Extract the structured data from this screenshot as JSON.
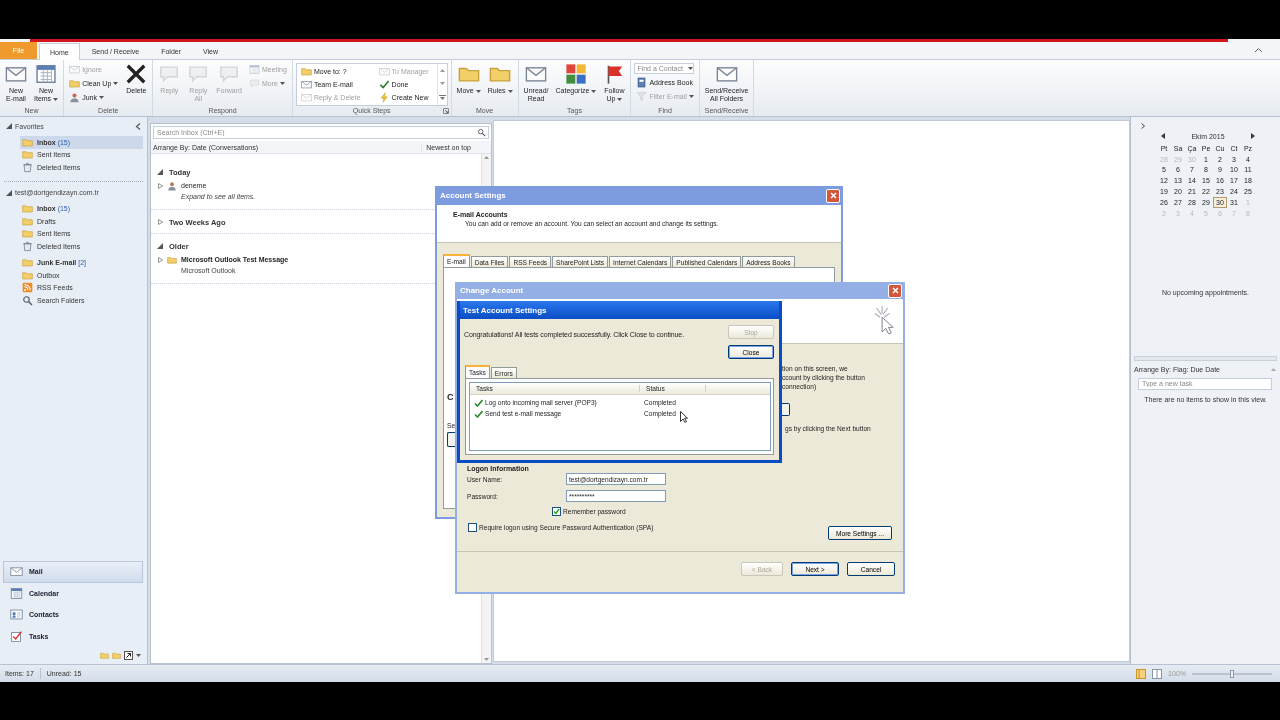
{
  "window": {
    "tabs": [
      {
        "label": "File",
        "kind": "file",
        "selected": false
      },
      {
        "label": "Home",
        "kind": "tab",
        "selected": true
      },
      {
        "label": "Send / Receive",
        "kind": "tab",
        "selected": false
      },
      {
        "label": "Folder",
        "kind": "tab",
        "selected": false
      },
      {
        "label": "View",
        "kind": "tab",
        "selected": false
      }
    ]
  },
  "ribbon": {
    "groups": [
      {
        "label": "New",
        "launcher": false,
        "buttons": [
          {
            "kind": "large",
            "label": "New\nE-mail",
            "disabled": false,
            "dropdown": false
          },
          {
            "kind": "large",
            "label": "New\nItems",
            "disabled": false,
            "dropdown": true
          }
        ]
      },
      {
        "label": "Delete",
        "launcher": false,
        "buttons": [
          {
            "kind": "small",
            "label": "Ignore",
            "disabled": true,
            "dropdown": false
          },
          {
            "kind": "small",
            "label": "Clean Up",
            "disabled": false,
            "dropdown": true
          },
          {
            "kind": "small",
            "label": "Junk",
            "disabled": false,
            "dropdown": true
          },
          {
            "kind": "large",
            "label": "Delete",
            "disabled": false,
            "dropdown": false
          }
        ]
      },
      {
        "label": "Respond",
        "launcher": false,
        "buttons": [
          {
            "kind": "large",
            "label": "Reply",
            "disabled": true,
            "dropdown": false
          },
          {
            "kind": "large",
            "label": "Reply\nAll",
            "disabled": true,
            "dropdown": false
          },
          {
            "kind": "large",
            "label": "Forward",
            "disabled": true,
            "dropdown": false
          },
          {
            "kind": "small",
            "label": "Meeting",
            "disabled": true,
            "dropdown": false
          },
          {
            "kind": "small",
            "label": "More",
            "disabled": true,
            "dropdown": true
          }
        ]
      },
      {
        "label": "Quick Steps",
        "launcher": true,
        "buttons": [
          {
            "kind": "quickstep",
            "label": "Move to: ?",
            "disabled": false
          },
          {
            "kind": "quickstep",
            "label": "Team E-mail",
            "disabled": false
          },
          {
            "kind": "quickstep",
            "label": "Reply & Delete",
            "disabled": true
          },
          {
            "kind": "quickstep",
            "label": "To Manager",
            "disabled": true
          },
          {
            "kind": "quickstep",
            "label": "Done",
            "disabled": false
          },
          {
            "kind": "quickstep",
            "label": "Create New",
            "disabled": false
          }
        ]
      },
      {
        "label": "Move",
        "launcher": false,
        "buttons": [
          {
            "kind": "large",
            "label": "Move",
            "disabled": false,
            "dropdown": true
          },
          {
            "kind": "large",
            "label": "Rules",
            "disabled": false,
            "dropdown": true
          }
        ]
      },
      {
        "label": "Tags",
        "launcher": false,
        "buttons": [
          {
            "kind": "large",
            "label": "Unread/\nRead",
            "disabled": false,
            "dropdown": false
          },
          {
            "kind": "large",
            "label": "Categorize",
            "disabled": false,
            "dropdown": true
          },
          {
            "kind": "large",
            "label": "Follow\nUp",
            "disabled": false,
            "dropdown": true
          }
        ]
      },
      {
        "label": "Find",
        "launcher": false,
        "buttons": [
          {
            "kind": "field",
            "placeholder": "Find a Contact",
            "dropdown": true
          },
          {
            "kind": "small",
            "label": "Address Book",
            "disabled": false,
            "dropdown": false
          },
          {
            "kind": "small",
            "label": "Filter E-mail",
            "disabled": true,
            "dropdown": true
          }
        ]
      },
      {
        "label": "Send/Receive",
        "launcher": false,
        "buttons": [
          {
            "kind": "large",
            "label": "Send/Receive\nAll Folders",
            "disabled": false,
            "dropdown": false
          }
        ]
      }
    ]
  },
  "nav": {
    "favorites": {
      "label": "Favorites",
      "expanded": true,
      "items": [
        {
          "label": "Inbox",
          "count": "(15)",
          "unread": true,
          "selected": true
        },
        {
          "label": "Sent Items",
          "unread": false,
          "selected": false
        },
        {
          "label": "Deleted Items",
          "unread": false,
          "selected": false
        }
      ]
    },
    "account": {
      "label": "test@dortgendizayn.com.tr",
      "expanded": true,
      "items": [
        {
          "label": "Inbox",
          "count": "(15)",
          "unread": true,
          "selected": false
        },
        {
          "label": "Drafts",
          "unread": false,
          "selected": false
        },
        {
          "label": "Sent Items",
          "unread": false,
          "selected": false
        },
        {
          "label": "Deleted Items",
          "unread": false,
          "selected": false
        },
        {
          "label": "Junk E-mail",
          "count": "[2]",
          "unread": true,
          "selected": false
        },
        {
          "label": "Outbox",
          "unread": false,
          "selected": false
        },
        {
          "label": "RSS Feeds",
          "unread": false,
          "selected": false
        },
        {
          "label": "Search Folders",
          "unread": false,
          "selected": false
        }
      ]
    },
    "modules": [
      {
        "label": "Mail",
        "selected": true
      },
      {
        "label": "Calendar",
        "selected": false
      },
      {
        "label": "Contacts",
        "selected": false
      },
      {
        "label": "Tasks",
        "selected": false
      }
    ]
  },
  "message_list": {
    "search_placeholder": "Search Inbox (Ctrl+E)",
    "arrange_by": "Arrange By: Date (Conversations)",
    "sort_order": "Newest on top",
    "groups": [
      {
        "label": "Today",
        "expanded": true,
        "items": [
          {
            "kind": "conversation",
            "title": "deneme",
            "subtitle": "Expand to see all items.",
            "expanded": false
          }
        ]
      },
      {
        "label": "Two Weeks Ago",
        "expanded": false
      },
      {
        "label": "Older",
        "expanded": true,
        "items": [
          {
            "kind": "message",
            "title": "Microsoft Outlook Test Message",
            "subtitle": "Microsoft Outlook",
            "expanded": false
          }
        ]
      }
    ]
  },
  "todo": {
    "calendar": {
      "month": "Ekim 2015",
      "weekdays": [
        "Pt",
        "Sa",
        "Ça",
        "Pe",
        "Cu",
        "Ct",
        "Pz"
      ],
      "days": [
        {
          "day": "28",
          "muted": true,
          "selected": false
        },
        {
          "day": "29",
          "muted": true,
          "selected": false
        },
        {
          "day": "30",
          "muted": true,
          "selected": false
        },
        {
          "day": "1",
          "muted": false,
          "selected": false
        },
        {
          "day": "2",
          "muted": false,
          "selected": false
        },
        {
          "day": "3",
          "muted": false,
          "selected": false
        },
        {
          "day": "4",
          "muted": false,
          "selected": false
        },
        {
          "day": "5",
          "muted": false,
          "selected": false
        },
        {
          "day": "6",
          "muted": false,
          "selected": false
        },
        {
          "day": "7",
          "muted": false,
          "selected": false
        },
        {
          "day": "8",
          "muted": false,
          "selected": false
        },
        {
          "day": "9",
          "muted": false,
          "selected": false
        },
        {
          "day": "10",
          "muted": false,
          "selected": false
        },
        {
          "day": "11",
          "muted": false,
          "selected": false
        },
        {
          "day": "12",
          "muted": false,
          "selected": false
        },
        {
          "day": "13",
          "muted": false,
          "selected": false
        },
        {
          "day": "14",
          "muted": false,
          "selected": false
        },
        {
          "day": "15",
          "muted": false,
          "selected": false
        },
        {
          "day": "16",
          "muted": false,
          "selected": false
        },
        {
          "day": "17",
          "muted": false,
          "selected": false
        },
        {
          "day": "18",
          "muted": false,
          "selected": false
        },
        {
          "day": "19",
          "muted": false,
          "selected": false
        },
        {
          "day": "20",
          "muted": false,
          "selected": false
        },
        {
          "day": "21",
          "muted": false,
          "selected": false
        },
        {
          "day": "22",
          "muted": false,
          "selected": false
        },
        {
          "day": "23",
          "muted": false,
          "selected": false
        },
        {
          "day": "24",
          "muted": false,
          "selected": false
        },
        {
          "day": "25",
          "muted": false,
          "selected": false
        },
        {
          "day": "26",
          "muted": false,
          "selected": false
        },
        {
          "day": "27",
          "muted": false,
          "selected": false
        },
        {
          "day": "28",
          "muted": false,
          "selected": false
        },
        {
          "day": "29",
          "muted": false,
          "selected": false
        },
        {
          "day": "30",
          "muted": false,
          "selected": true
        },
        {
          "day": "31",
          "muted": false,
          "selected": false
        },
        {
          "day": "1",
          "muted": true,
          "selected": false
        },
        {
          "day": "2",
          "muted": true,
          "selected": false
        },
        {
          "day": "3",
          "muted": true,
          "selected": false
        },
        {
          "day": "4",
          "muted": true,
          "selected": false
        },
        {
          "day": "5",
          "muted": true,
          "selected": false
        },
        {
          "day": "6",
          "muted": true,
          "selected": false
        },
        {
          "day": "7",
          "muted": true,
          "selected": false
        },
        {
          "day": "8",
          "muted": true,
          "selected": false
        }
      ]
    },
    "appointments": "No upcoming appointments.",
    "tasks": {
      "arrange_by": "Arrange By: Flag: Due Date",
      "placeholder": "Type a new task",
      "empty": "There are no items to show in this view."
    }
  },
  "status_bar": {
    "items": "Items: 17",
    "unread": "Unread: 15",
    "zoom": "100%",
    "zoom_slider": {
      "level": 0.5
    }
  },
  "account_settings": {
    "title": "Account Settings",
    "heading": "E-mail Accounts",
    "description": "You can add or remove an account. You can select an account and change its settings.",
    "tabs": [
      {
        "label": "E-mail",
        "selected": true
      },
      {
        "label": "Data Files",
        "selected": false
      },
      {
        "label": "RSS Feeds",
        "selected": false
      },
      {
        "label": "SharePoint Lists",
        "selected": false
      },
      {
        "label": "Internet Calendars",
        "selected": false
      },
      {
        "label": "Published Calendars",
        "selected": false
      },
      {
        "label": "Address Books",
        "selected": false
      }
    ],
    "partial_texts": [
      "C",
      "Se"
    ]
  },
  "change_account": {
    "title": "Change Account",
    "partial_lines": [
      "tion on this screen, we",
      "ccount by clicking the button",
      "connection)"
    ],
    "partial_line_2": "gs by clicking the Next button",
    "logon": {
      "heading": "Logon Information",
      "fields": [
        {
          "label": "User Name:",
          "value": "test@dortgendizayn.com.tr"
        },
        {
          "label": "Password:",
          "value": "**********"
        }
      ],
      "remember": {
        "label": "Remember password",
        "checked": true
      },
      "spa": {
        "label": "Require logon using Secure Password Authentication (SPA)",
        "checked": false
      }
    },
    "more_settings": {
      "label": "More Settings ...",
      "disabled": false,
      "default": false
    },
    "buttons": [
      {
        "label": "< Back",
        "disabled": true,
        "default": false
      },
      {
        "label": "Next >",
        "disabled": false,
        "default": true
      },
      {
        "label": "Cancel",
        "disabled": false,
        "default": false
      }
    ]
  },
  "test_account": {
    "title": "Test Account Settings",
    "message": "Congratulations! All tests completed successfully. Click Close to continue.",
    "buttons": [
      {
        "label": "Stop",
        "disabled": true,
        "default": false
      },
      {
        "label": "Close",
        "disabled": false,
        "default": true
      }
    ],
    "tabs": [
      {
        "label": "Tasks",
        "selected": true
      },
      {
        "label": "Errors",
        "selected": false
      }
    ],
    "columns": [
      "Tasks",
      "Status"
    ],
    "rows": [
      {
        "task": "Log onto incoming mail server (POP3)",
        "status": "Completed",
        "done": true
      },
      {
        "task": "Send test e-mail message",
        "status": "Completed",
        "done": true
      }
    ]
  }
}
